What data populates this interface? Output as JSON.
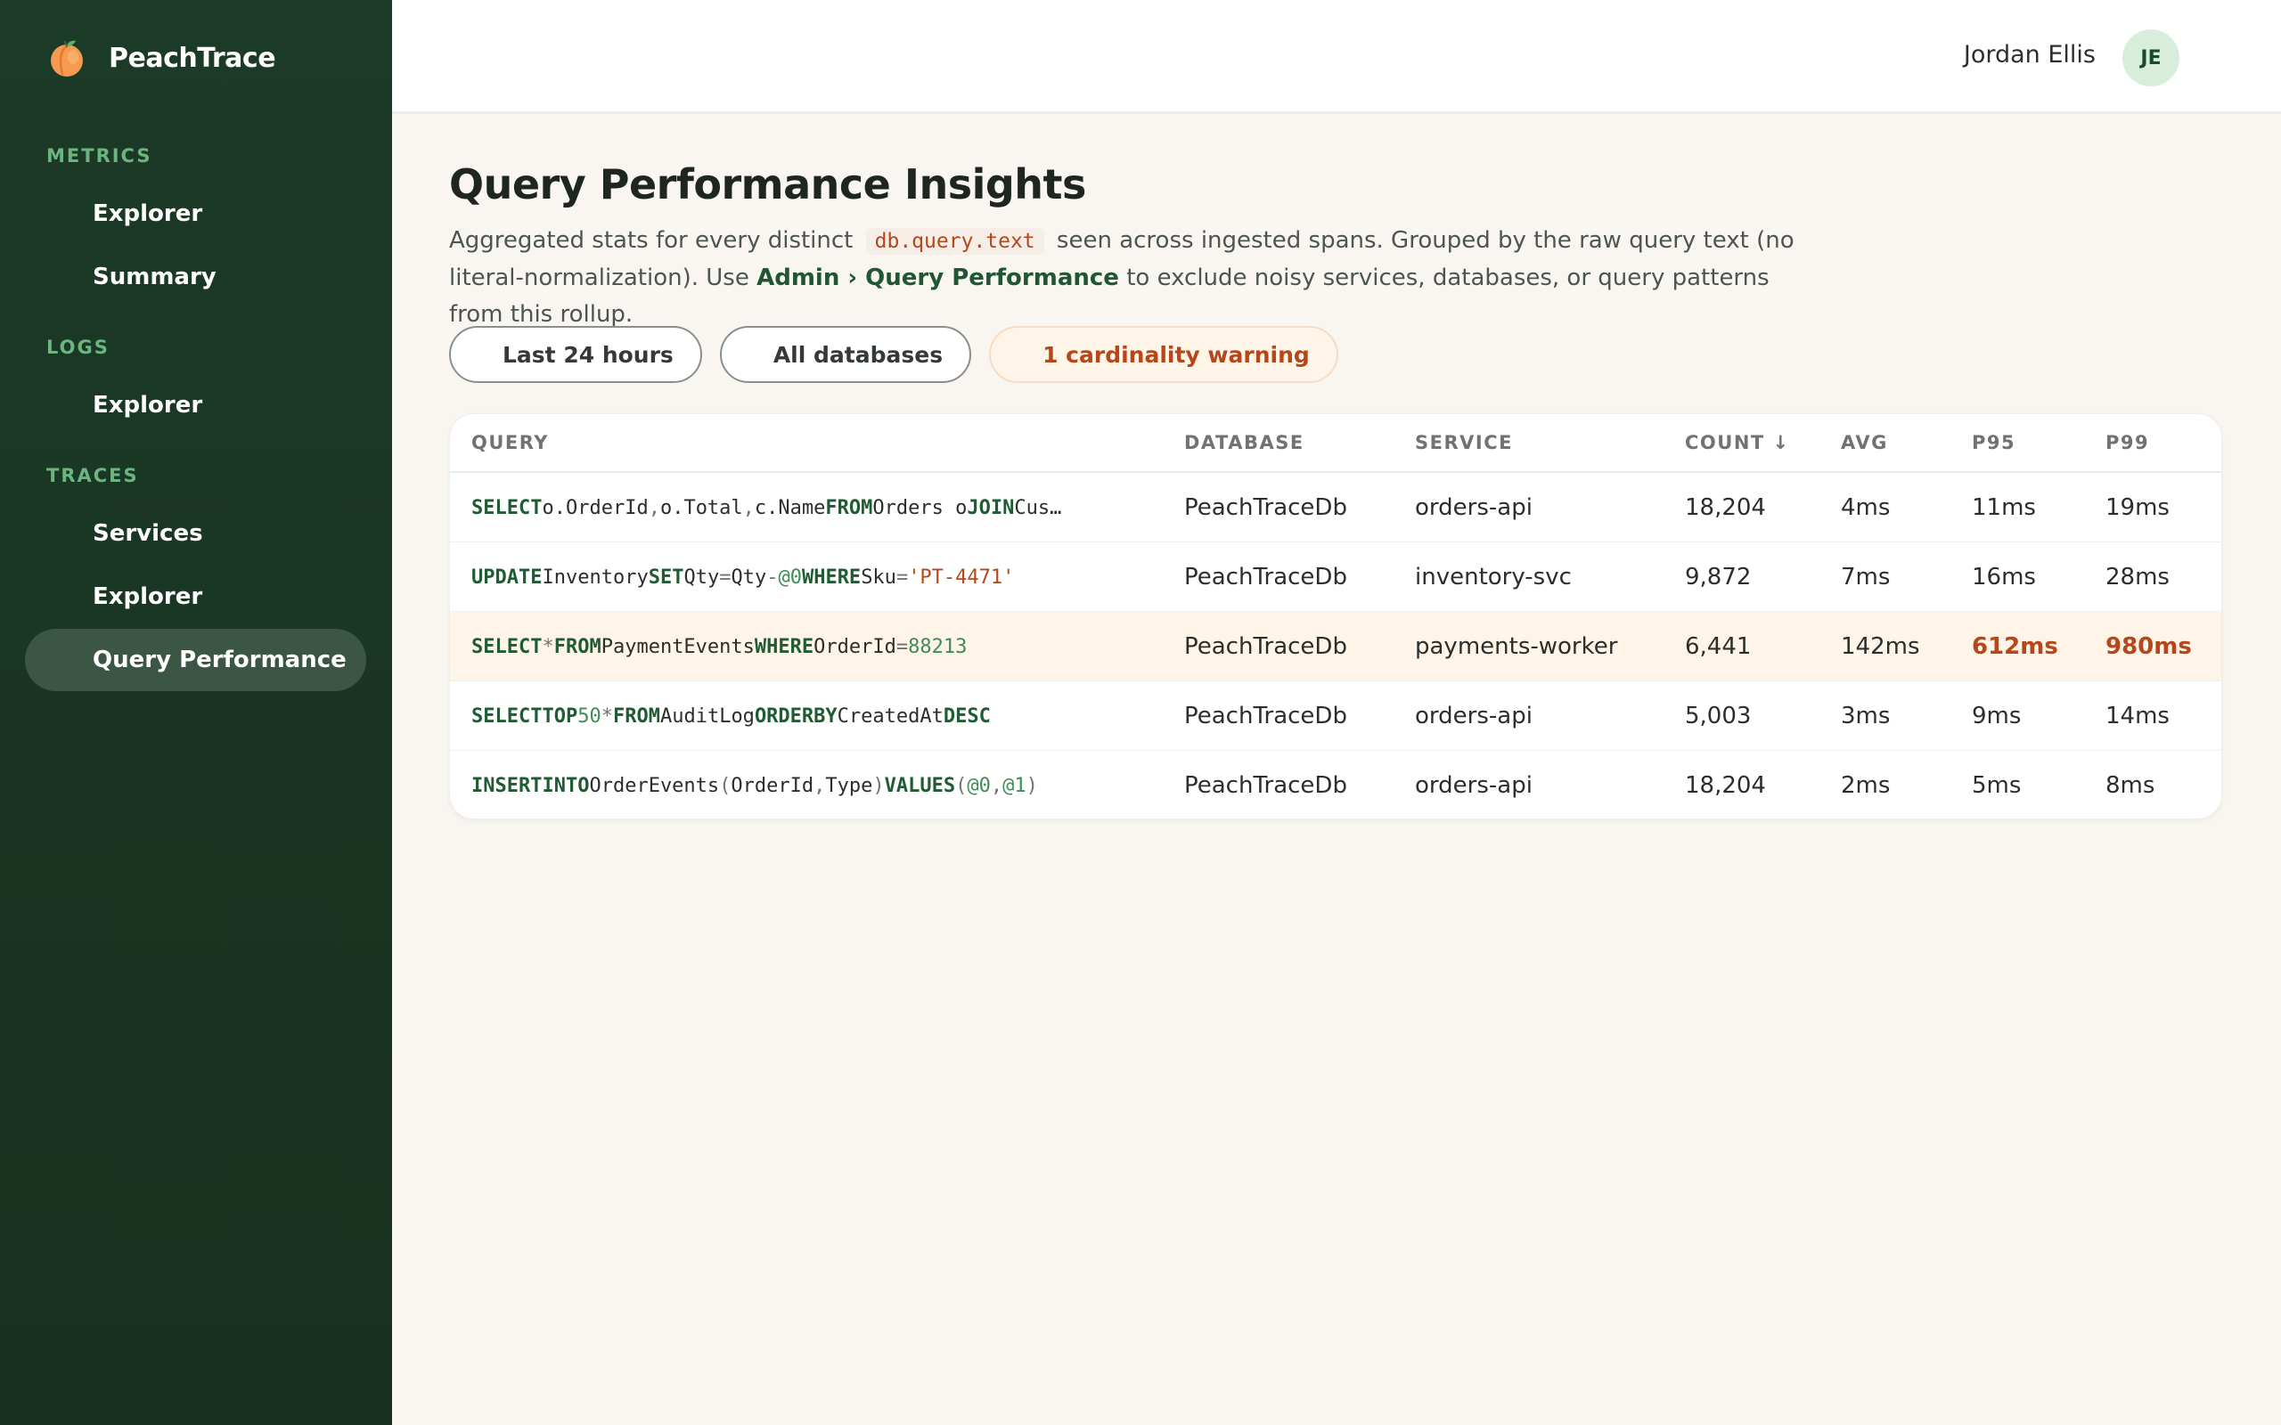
{
  "brand": {
    "name": "PeachTrace",
    "logo_icon": "peach-icon"
  },
  "sidebar": {
    "sections": [
      {
        "heading": "METRICS",
        "items": [
          {
            "label": "Explorer"
          },
          {
            "label": "Summary"
          }
        ]
      },
      {
        "heading": "LOGS",
        "items": [
          {
            "label": "Explorer"
          }
        ]
      },
      {
        "heading": "TRACES",
        "items": [
          {
            "label": "Services"
          },
          {
            "label": "Explorer"
          },
          {
            "label": "Query Performance",
            "active": true
          }
        ]
      }
    ]
  },
  "user": {
    "name": "Jordan Ellis",
    "initials": "JE"
  },
  "page": {
    "title": "Query Performance Insights",
    "description_pre": "Aggregated stats for every distinct",
    "description_code": "db.query.text",
    "description_mid": "seen across ingested spans. Grouped by the raw query text (no literal-normalization). Use",
    "description_link": "Admin › Query Performance",
    "description_post": "to exclude noisy services, databases, or query patterns from this rollup."
  },
  "filters": {
    "time_range": "Last 24 hours",
    "database": "All databases",
    "warning": "1 cardinality warning"
  },
  "table": {
    "columns": {
      "query": "QUERY",
      "database": "DATABASE",
      "service": "SERVICE",
      "count": "COUNT ↓",
      "avg": "AVG",
      "p95": "P95",
      "p99": "P99"
    },
    "rows": [
      {
        "query": "SELECT o.OrderId, o.Total, c.Name FROM Orders o JOIN Cus…",
        "database": "PeachTraceDb",
        "service": "orders-api",
        "count": "18,204",
        "avg": "4ms",
        "p95": "11ms",
        "p99": "19ms",
        "highlight": false
      },
      {
        "query": "UPDATE Inventory SET Qty = Qty - @0 WHERE Sku = 'PT-4471'",
        "database": "PeachTraceDb",
        "service": "inventory-svc",
        "count": "9,872",
        "avg": "7ms",
        "p95": "16ms",
        "p99": "28ms",
        "highlight": false
      },
      {
        "query": "SELECT * FROM PaymentEvents WHERE OrderId = 88213",
        "database": "PeachTraceDb",
        "service": "payments-worker",
        "count": "6,441",
        "avg": "142ms",
        "p95": "612ms",
        "p99": "980ms",
        "highlight": true
      },
      {
        "query": "SELECT TOP 50 * FROM AuditLog ORDER BY CreatedAt DESC",
        "database": "PeachTraceDb",
        "service": "orders-api",
        "count": "5,003",
        "avg": "3ms",
        "p95": "9ms",
        "p99": "14ms",
        "highlight": false
      },
      {
        "query": "INSERT INTO OrderEvents (OrderId,Type) VALUES (@0,@1)",
        "database": "PeachTraceDb",
        "service": "orders-api",
        "count": "18,204",
        "avg": "2ms",
        "p95": "5ms",
        "p99": "8ms",
        "highlight": false
      }
    ]
  },
  "colors": {
    "sidebar_bg": "#1c3a28",
    "accent_green": "#1f5633",
    "warning_orange": "#b5471a",
    "highlight_bg": "#fff4e8"
  }
}
